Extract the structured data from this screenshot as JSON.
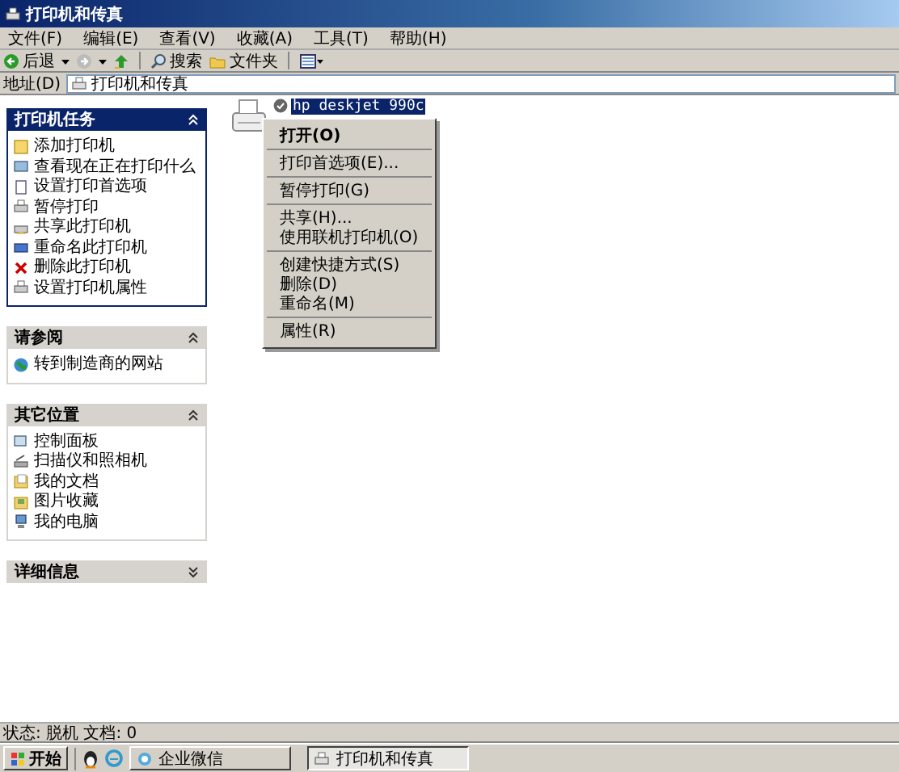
{
  "window": {
    "title": "打印机和传真"
  },
  "menu_bar": [
    "文件(F)",
    "编辑(E)",
    "查看(V)",
    "收藏(A)",
    "工具(T)",
    "帮助(H)"
  ],
  "toolbar": {
    "back": "后退",
    "search": "搜索",
    "folders": "文件夹"
  },
  "address_bar": {
    "label": "地址(D)",
    "value": "打印机和传真"
  },
  "panels": [
    {
      "title": "打印机任务",
      "expanded": true,
      "items": [
        "添加打印机",
        "查看现在正在打印什么",
        "设置打印首选项",
        "暂停打印",
        "共享此打印机",
        "重命名此打印机",
        "删除此打印机",
        "设置打印机属性"
      ]
    },
    {
      "title": "请参阅",
      "expanded": true,
      "items": [
        "转到制造商的网站"
      ]
    },
    {
      "title": "其它位置",
      "expanded": true,
      "items": [
        "控制面板",
        "扫描仪和照相机",
        "我的文档",
        "图片收藏",
        "我的电脑"
      ]
    },
    {
      "title": "详细信息",
      "expanded": false
    }
  ],
  "printer": {
    "name": "hp deskjet 990c",
    "selected": true,
    "default": true
  },
  "context_menu": [
    [
      {
        "label": "打开(O)",
        "bold": true
      }
    ],
    [
      {
        "label": "打印首选项(E)...",
        "bold": false
      }
    ],
    [
      {
        "label": "暂停打印(G)",
        "bold": false
      }
    ],
    [
      {
        "label": "共享(H)...",
        "bold": false
      },
      {
        "label": "使用联机打印机(O)",
        "bold": false
      }
    ],
    [
      {
        "label": "创建快捷方式(S)",
        "bold": false
      },
      {
        "label": "删除(D)",
        "bold": false
      },
      {
        "label": "重命名(M)",
        "bold": false
      }
    ],
    [
      {
        "label": "属性(R)",
        "bold": false
      }
    ]
  ],
  "status_bar": "状态: 脱机 文档: 0",
  "taskbar": {
    "start": "开始",
    "tasks": [
      {
        "label": "企业微信",
        "selected": false
      },
      {
        "label": "打印机和传真",
        "selected": true
      }
    ]
  }
}
